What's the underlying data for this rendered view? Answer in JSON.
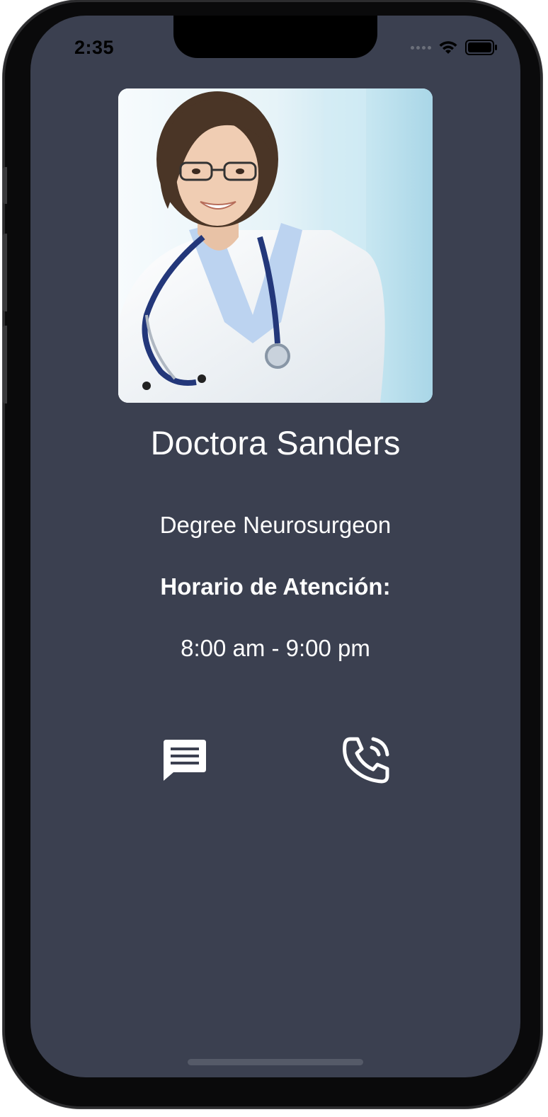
{
  "status_bar": {
    "time": "2:35"
  },
  "doctor": {
    "name": "Doctora Sanders",
    "degree": "Degree Neurosurgeon",
    "hours_label": "Horario de Atención:",
    "hours": "8:00 am - 9:00 pm"
  },
  "actions": {
    "message_icon": "message-icon",
    "call_icon": "phone-call-icon"
  },
  "colors": {
    "background": "#3b4050",
    "text": "#ffffff"
  }
}
